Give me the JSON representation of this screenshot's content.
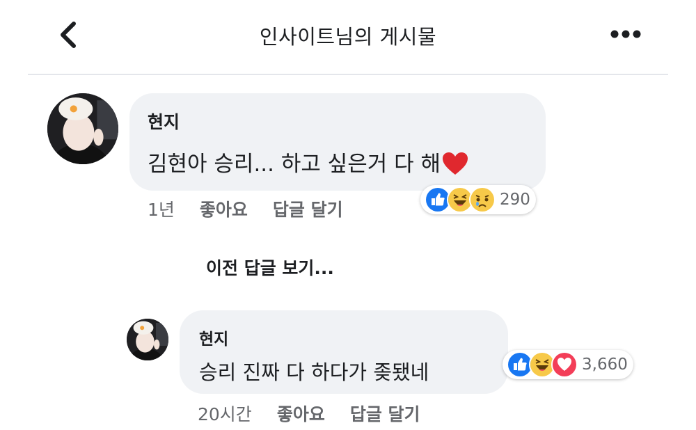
{
  "header": {
    "title": "인사이트님의 게시물",
    "back_icon": "chevron-left-icon",
    "more_icon": "more-dots-icon"
  },
  "comment": {
    "author": "현지",
    "text": "김현아 승리... 하고 싶은거 다 해",
    "text_emoji": "red-heart-icon",
    "time": "1년",
    "like_label": "좋아요",
    "reply_label": "답글 달기",
    "reactions": [
      "like-icon",
      "haha-icon",
      "sad-icon"
    ],
    "reaction_count": "290"
  },
  "prev_replies_label": "이전 답글 보기...",
  "reply": {
    "author": "현지",
    "text": "승리 진짜 다 하다가 좆됐네",
    "time": "20시간",
    "like_label": "좋아요",
    "reply_label": "답글 달기",
    "reactions": [
      "like-icon",
      "haha-icon",
      "love-icon"
    ],
    "reaction_count": "3,660"
  },
  "colors": {
    "like_blue": "#1877f2",
    "haha_yellow": "#f7c949",
    "love_red": "#f33e58",
    "bubble_bg": "#f0f2f5",
    "meta_gray": "#65676b"
  }
}
